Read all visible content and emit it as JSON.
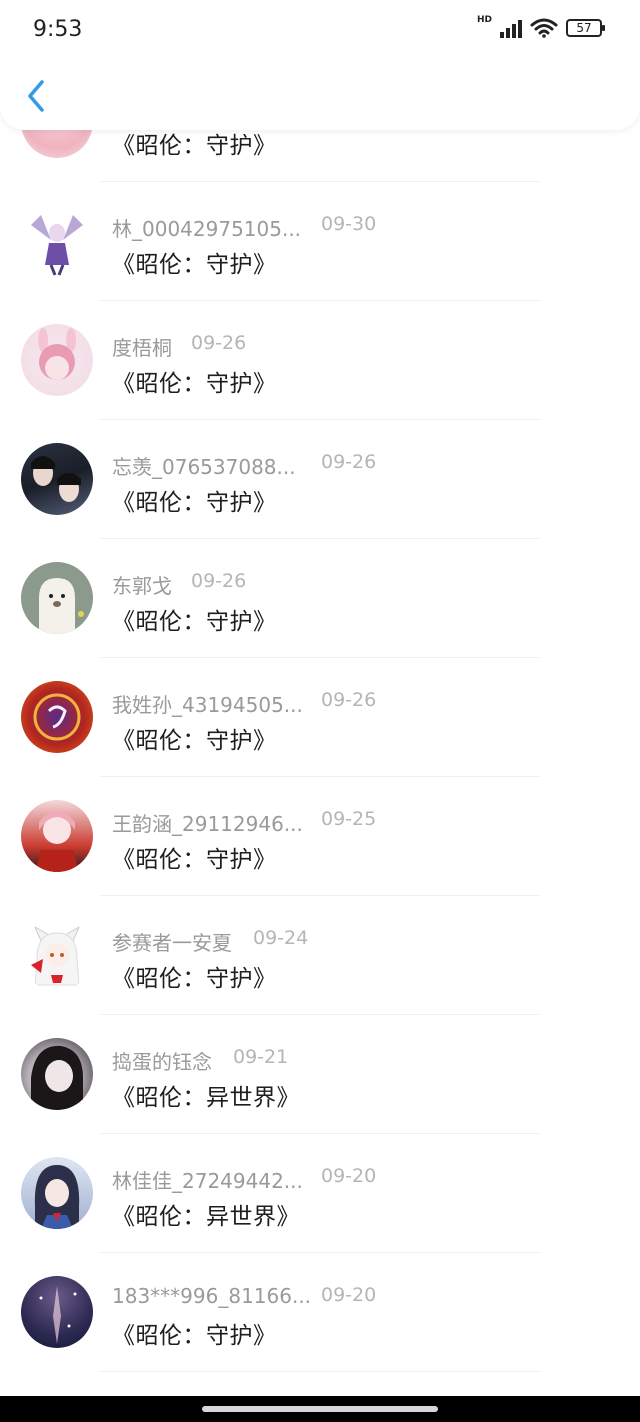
{
  "status_bar": {
    "time": "9:53",
    "network": "HD",
    "battery": "57"
  },
  "header": {
    "back_icon": "chevron-left-icon",
    "accent_color": "#2f9ae6"
  },
  "items": [
    {
      "name": "",
      "date": "",
      "book": "《昭伦：守护》"
    },
    {
      "name": "林_00042975105...",
      "date": "09-30",
      "book": "《昭伦：守护》"
    },
    {
      "name": "度梧桐",
      "date": "09-26",
      "book": "《昭伦：守护》"
    },
    {
      "name": "忘羡_076537088...",
      "date": "09-26",
      "book": "《昭伦：守护》"
    },
    {
      "name": "东郭戈",
      "date": "09-26",
      "book": "《昭伦：守护》"
    },
    {
      "name": "我姓孙_43194505...",
      "date": "09-26",
      "book": "《昭伦：守护》"
    },
    {
      "name": "王韵涵_29112946...",
      "date": "09-25",
      "book": "《昭伦：守护》"
    },
    {
      "name": "参赛者一安夏",
      "date": "09-24",
      "book": "《昭伦：守护》"
    },
    {
      "name": "捣蛋的钰念",
      "date": "09-21",
      "book": "《昭伦：异世界》"
    },
    {
      "name": "林佳佳_27249442...",
      "date": "09-20",
      "book": "《昭伦：异世界》"
    },
    {
      "name": "183***996_81166...",
      "date": "09-20",
      "book": "《昭伦：守护》"
    }
  ]
}
